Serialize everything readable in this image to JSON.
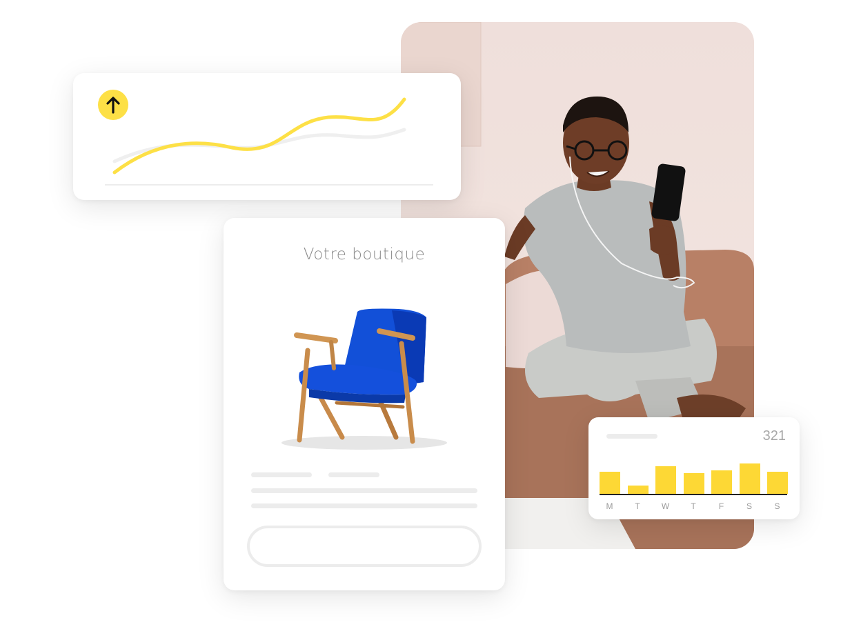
{
  "shop": {
    "title": "Votre boutique"
  },
  "trend": {
    "icon": "arrow-up-icon",
    "accent_color": "#fde046",
    "secondary_line_color": "#efefef"
  },
  "chart_data": {
    "type": "bar",
    "categories": [
      "M",
      "T",
      "W",
      "T",
      "F",
      "S",
      "S"
    ],
    "values": [
      32,
      12,
      40,
      30,
      34,
      44,
      32
    ],
    "ylim": [
      0,
      50
    ],
    "headline_value": "321",
    "bar_color": "#fdd835",
    "grid": false
  },
  "photo": {
    "description_icon": "person-on-couch-photo"
  }
}
